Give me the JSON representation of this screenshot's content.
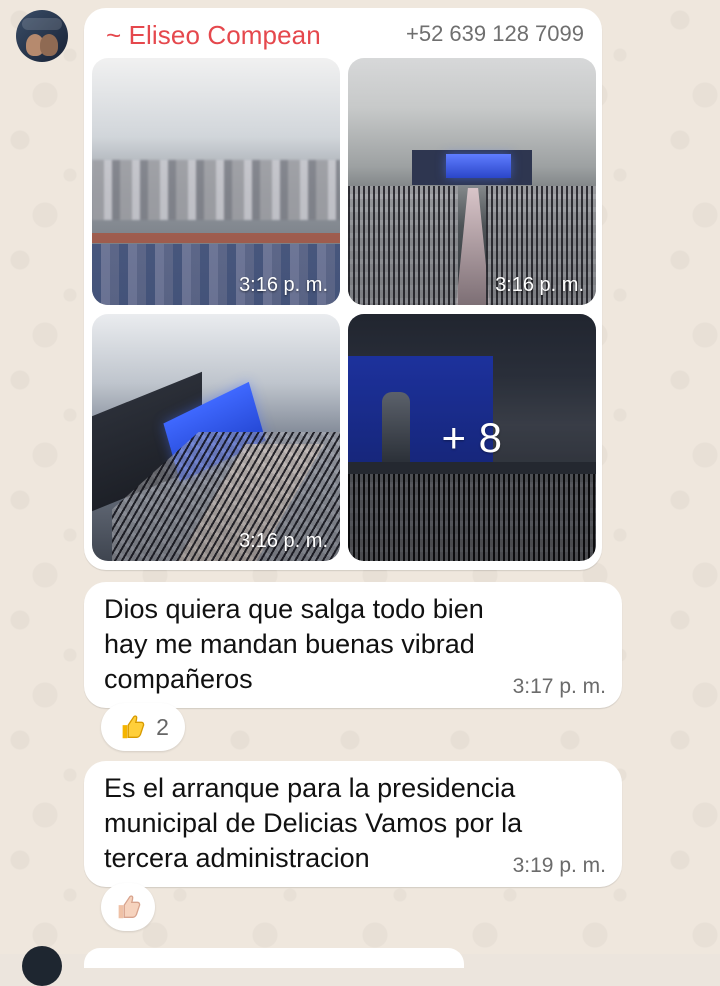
{
  "sender": {
    "name": "~ Eliseo Compean",
    "phone": "+52 639 128 7099"
  },
  "media": [
    {
      "time": "3:16 p. m.",
      "icon": "photo-auditorium-blurred"
    },
    {
      "time": "3:16 p. m.",
      "icon": "photo-auditorium-stage"
    },
    {
      "time": "3:16 p. m.",
      "icon": "photo-auditorium-angle"
    }
  ],
  "more_photos": "+ 8",
  "messages": [
    {
      "text": "Dios quiera que salga todo bien hay me mandan buenas vibrad compañeros",
      "time": "3:17 p. m."
    },
    {
      "text": "Es el arranque para la presidencia municipal de Delicias Vamos por la tercera administracion",
      "time": "3:19 p. m."
    }
  ],
  "reactions": [
    {
      "emoji_icon": "thumbs-up-yellow",
      "count": "2"
    },
    {
      "emoji_icon": "thumbs-up-light-skin"
    }
  ],
  "colors": {
    "sender_name": "#e5484d",
    "bubble_bg": "#ffffff",
    "chat_bg": "#efe7dd"
  }
}
